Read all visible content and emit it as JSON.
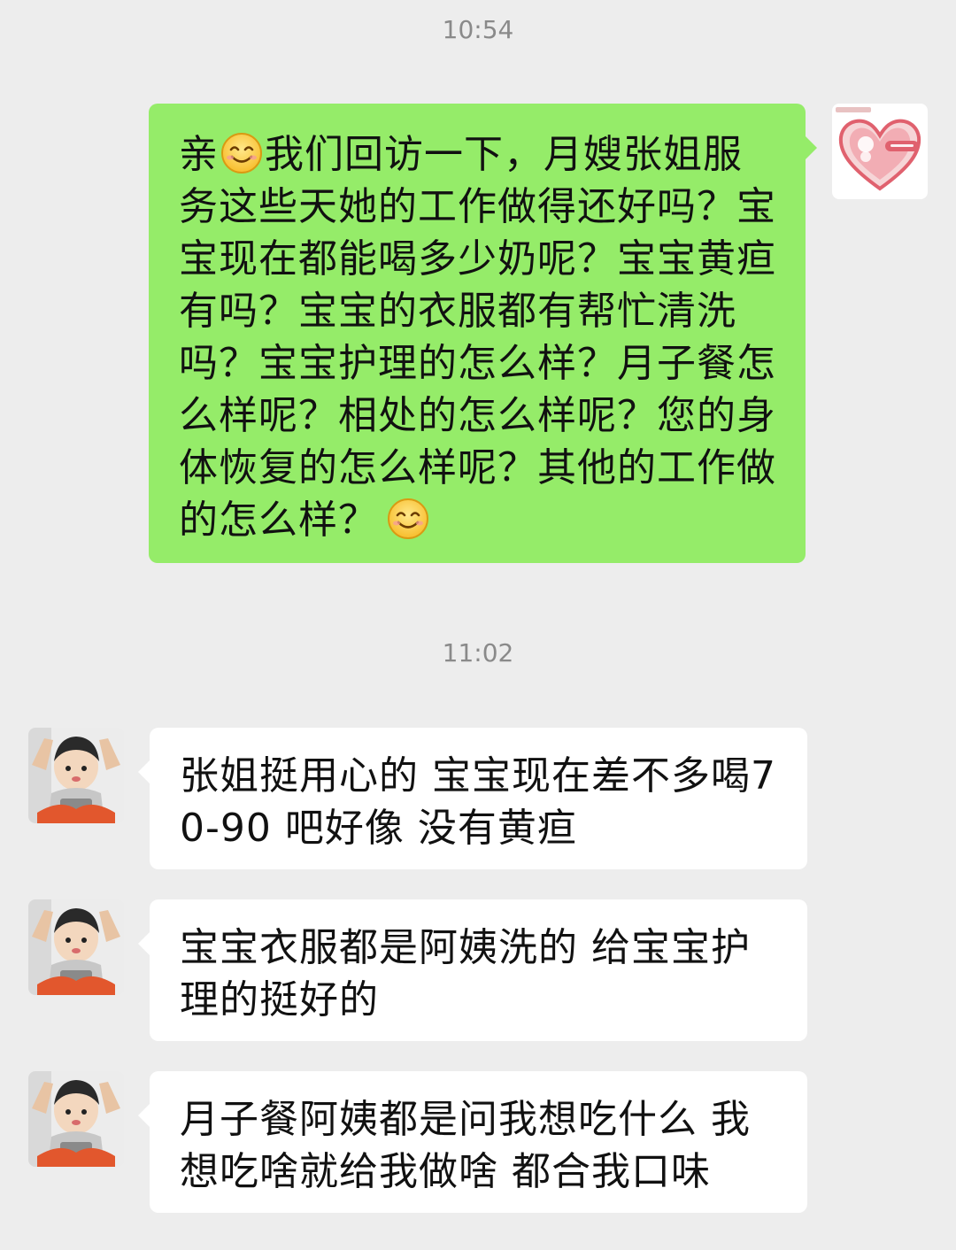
{
  "timestamps": [
    "10:54",
    "11:02"
  ],
  "messages": [
    {
      "sender": "self",
      "parts": [
        "亲",
        "smile-emoji",
        "我们回访一下，月嫂张姐服务这些天她的工作做得还好吗？宝宝现在都能喝多少奶呢？宝宝黄疸有吗？宝宝的衣服都有帮忙清洗吗？宝宝护理的怎么样？月子餐怎么样呢？相处的怎么样呢？您的身体恢复的怎么样呢？其他的工作做的怎么样？",
        "smile-emoji"
      ]
    },
    {
      "sender": "other",
      "text": "张姐挺用心的 宝宝现在差不多喝70-90 吧好像 没有黄疸"
    },
    {
      "sender": "other",
      "text": "宝宝衣服都是阿姨洗的 给宝宝护理的挺好的"
    },
    {
      "sender": "other",
      "text": "月子餐阿姨都是问我想吃什么 我想吃啥就给我做啥 都合我口味"
    }
  ],
  "icons": {
    "self_avatar": "heart-logo-icon",
    "other_avatar": "child-photo-icon",
    "emoji": "smile-emoji"
  },
  "colors": {
    "background": "#ededed",
    "outgoing_bubble": "#95ec69",
    "incoming_bubble": "#ffffff",
    "timestamp": "#8a8a8a",
    "message_text": "#111111"
  }
}
